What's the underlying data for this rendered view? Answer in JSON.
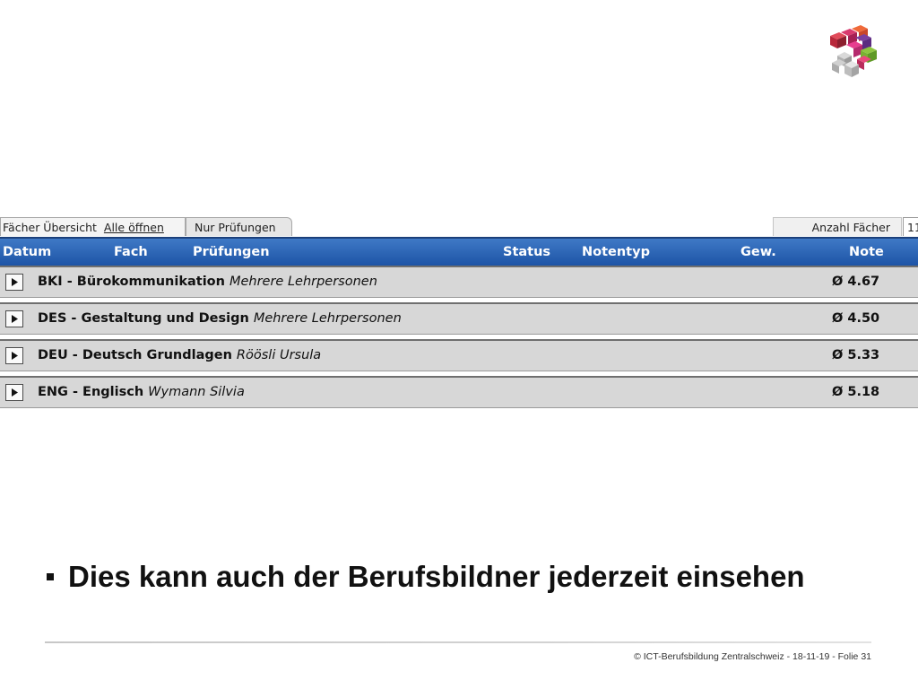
{
  "tabs": {
    "overview": "Fächer Übersicht",
    "open_all": "Alle öffnen",
    "exams_only": "Nur Prüfungen",
    "subject_count": "Anzahl Fächer",
    "count_value": "11"
  },
  "header": {
    "datum": "Datum",
    "fach": "Fach",
    "pruefungen": "Prüfungen",
    "status": "Status",
    "notentyp": "Notentyp",
    "gew": "Gew.",
    "note": "Note"
  },
  "rows": [
    {
      "subject": "BKI - Bürokommunikation",
      "teacher": "Mehrere Lehrpersonen",
      "grade": "Ø 4.67"
    },
    {
      "subject": "DES - Gestaltung und Design",
      "teacher": "Mehrere Lehrpersonen",
      "grade": "Ø 4.50"
    },
    {
      "subject": "DEU - Deutsch Grundlagen",
      "teacher": "Röösli Ursula",
      "grade": "Ø 5.33"
    },
    {
      "subject": "ENG - Englisch",
      "teacher": "Wymann Silvia",
      "grade": "Ø 5.18"
    }
  ],
  "slide": {
    "bullet": "Dies kann auch der Berufsbildner jederzeit einsehen",
    "footer": "© ICT-Berufsbildung Zentralschweiz - 18-11-19 - Folie 31"
  },
  "colors": {
    "header_blue": "#2b64b5",
    "row_gray": "#d7d7d7"
  }
}
